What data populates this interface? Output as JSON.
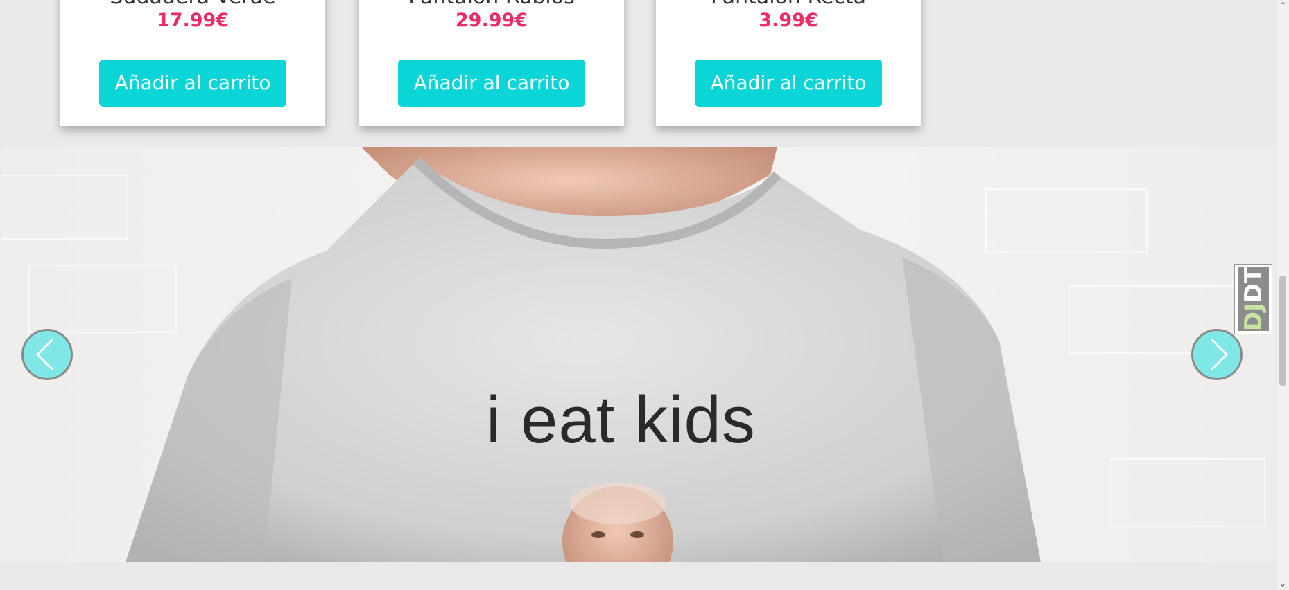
{
  "products": [
    {
      "name": "Sudadera Verde",
      "price": "17.99€",
      "button_label": "Añadir al carrito"
    },
    {
      "name": "Pantalon Rubios",
      "price": "29.99€",
      "button_label": "Añadir al carrito"
    },
    {
      "name": "Pantalon Recta",
      "price": "3.99€",
      "button_label": "Añadir al carrito"
    }
  ],
  "carousel": {
    "slide_text": "i eat kids",
    "prev_icon": "chevron-left-icon",
    "next_icon": "chevron-right-icon"
  },
  "debug_toolbar": {
    "label_dj": "DJ",
    "label_dt": "DT"
  },
  "scrollbar": {
    "up_glyph": "⌃",
    "down_glyph": "⌄"
  },
  "colors": {
    "accent": "#0bd5d6",
    "price": "#ee2a68",
    "arrow_fill": "#7fe7e5"
  }
}
